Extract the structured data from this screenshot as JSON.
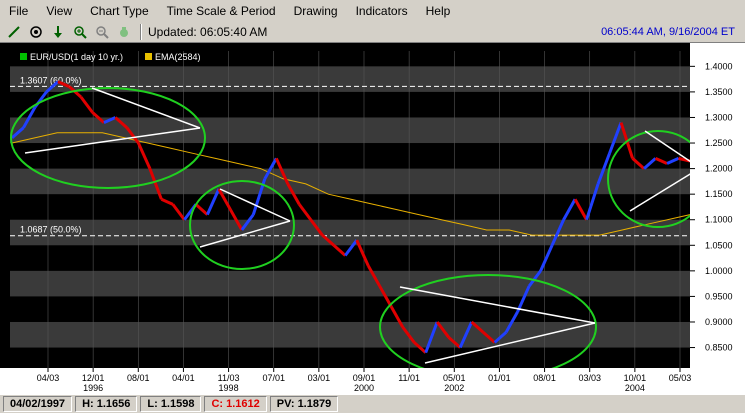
{
  "menu": [
    "File",
    "View",
    "Chart Type",
    "Time Scale & Period",
    "Drawing",
    "Indicators",
    "Help"
  ],
  "toolbar": {
    "icons": [
      "pencil-icon",
      "target-icon",
      "arrow-down-icon",
      "zoom-in-icon",
      "zoom-out-icon",
      "hand-icon"
    ],
    "updated": "Updated: 06:05:40 AM",
    "clock": "06:05:44 AM, 9/16/2004 ET"
  },
  "legend": {
    "series1": "EUR/USD(1 day  10 yr.)",
    "series2": "EMA(2584)",
    "series1_color": "#00c000",
    "series2_color": "#e8c000"
  },
  "levels": {
    "upper": "1.3607 (60.0%)",
    "lower": "1.0687 (50.0%)",
    "current": "1.2148"
  },
  "colors": {
    "price_up": "#2040ff",
    "price_down": "#e00000",
    "ema": "#e8b000",
    "ellipse": "#20d020",
    "trendline": "#ffffff",
    "band_dark": "#000000",
    "band_light": "#3a3a3a",
    "current_badge": "#1a8060"
  },
  "chart_data": {
    "type": "line",
    "ylim": [
      0.81,
      1.43
    ],
    "yticks": [
      "1.4000",
      "1.3500",
      "1.3000",
      "1.2500",
      "1.2000",
      "1.1500",
      "1.1000",
      "1.0500",
      "1.0000",
      "0.9500",
      "0.9000",
      "0.8500"
    ],
    "xtick_labels": [
      "04/03",
      "12/01",
      "08/01",
      "04/01",
      "11/03",
      "07/01",
      "03/01",
      "09/01",
      "11/01",
      "05/01",
      "01/01",
      "08/01",
      "03/03",
      "10/01",
      "05/03"
    ],
    "year_labels": [
      "1996",
      "1998",
      "2000",
      "2002",
      "2004"
    ],
    "series": [
      {
        "name": "EUR/USD(1 day  10 yr.)",
        "values": [
          1.26,
          1.28,
          1.32,
          1.35,
          1.37,
          1.36,
          1.34,
          1.31,
          1.29,
          1.3,
          1.28,
          1.25,
          1.2,
          1.14,
          1.13,
          1.1,
          1.13,
          1.11,
          1.16,
          1.12,
          1.08,
          1.11,
          1.18,
          1.22,
          1.17,
          1.13,
          1.1,
          1.07,
          1.05,
          1.03,
          1.06,
          1.01,
          0.97,
          0.93,
          0.89,
          0.86,
          0.84,
          0.9,
          0.87,
          0.85,
          0.9,
          0.88,
          0.86,
          0.88,
          0.92,
          0.97,
          1.0,
          1.05,
          1.1,
          1.14,
          1.1,
          1.17,
          1.23,
          1.29,
          1.22,
          1.2,
          1.22,
          1.21,
          1.22,
          1.2148
        ]
      },
      {
        "name": "EMA(2584)",
        "values": [
          1.25,
          1.26,
          1.27,
          1.27,
          1.27,
          1.26,
          1.25,
          1.24,
          1.23,
          1.22,
          1.21,
          1.2,
          1.18,
          1.17,
          1.15,
          1.14,
          1.13,
          1.12,
          1.11,
          1.1,
          1.09,
          1.08,
          1.08,
          1.07,
          1.07,
          1.07,
          1.07,
          1.08,
          1.09,
          1.1,
          1.11
        ]
      }
    ]
  },
  "status": {
    "date": "04/02/1997",
    "high": "H: 1.1656",
    "low": "L: 1.1598",
    "close": "C: 1.1612",
    "pv": "PV: 1.1879"
  }
}
